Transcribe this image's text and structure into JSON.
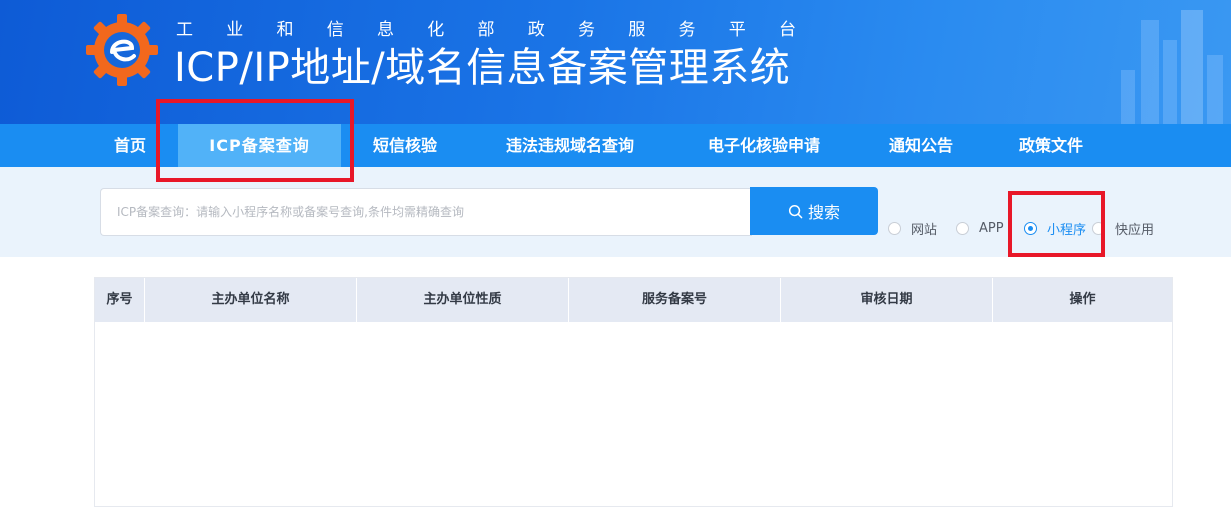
{
  "header": {
    "subtitle_chars": [
      "工",
      "业",
      "和",
      "信",
      "息",
      "化",
      "部",
      "政",
      "务",
      "服",
      "务",
      "平",
      "台"
    ],
    "title": "ICP/IP地址/域名信息备案管理系统",
    "logo_icon": "miit-gear-logo-icon"
  },
  "nav": {
    "items": [
      {
        "label": "首页",
        "active": false
      },
      {
        "label": "ICP备案查询",
        "active": true
      },
      {
        "label": "短信核验",
        "active": false
      },
      {
        "label": "违法违规域名查询",
        "active": false
      },
      {
        "label": "电子化核验申请",
        "active": false
      },
      {
        "label": "通知公告",
        "active": false
      },
      {
        "label": "政策文件",
        "active": false
      }
    ]
  },
  "search": {
    "placeholder": "ICP备案查询：请输入小程序名称或备案号查询,条件均需精确查询",
    "button_label": "搜索",
    "button_icon": "search-icon"
  },
  "radios": [
    {
      "label": "网站",
      "checked": false
    },
    {
      "label": "APP",
      "checked": false
    },
    {
      "label": "小程序",
      "checked": true
    },
    {
      "label": "快应用",
      "checked": false
    }
  ],
  "table": {
    "columns": [
      "序号",
      "主办单位名称",
      "主办单位性质",
      "服务备案号",
      "审核日期",
      "操作"
    ],
    "rows": []
  },
  "colors": {
    "primary": "#1a8df2",
    "nav_active": "#51b2f8",
    "highlight_box": "#e81728"
  }
}
